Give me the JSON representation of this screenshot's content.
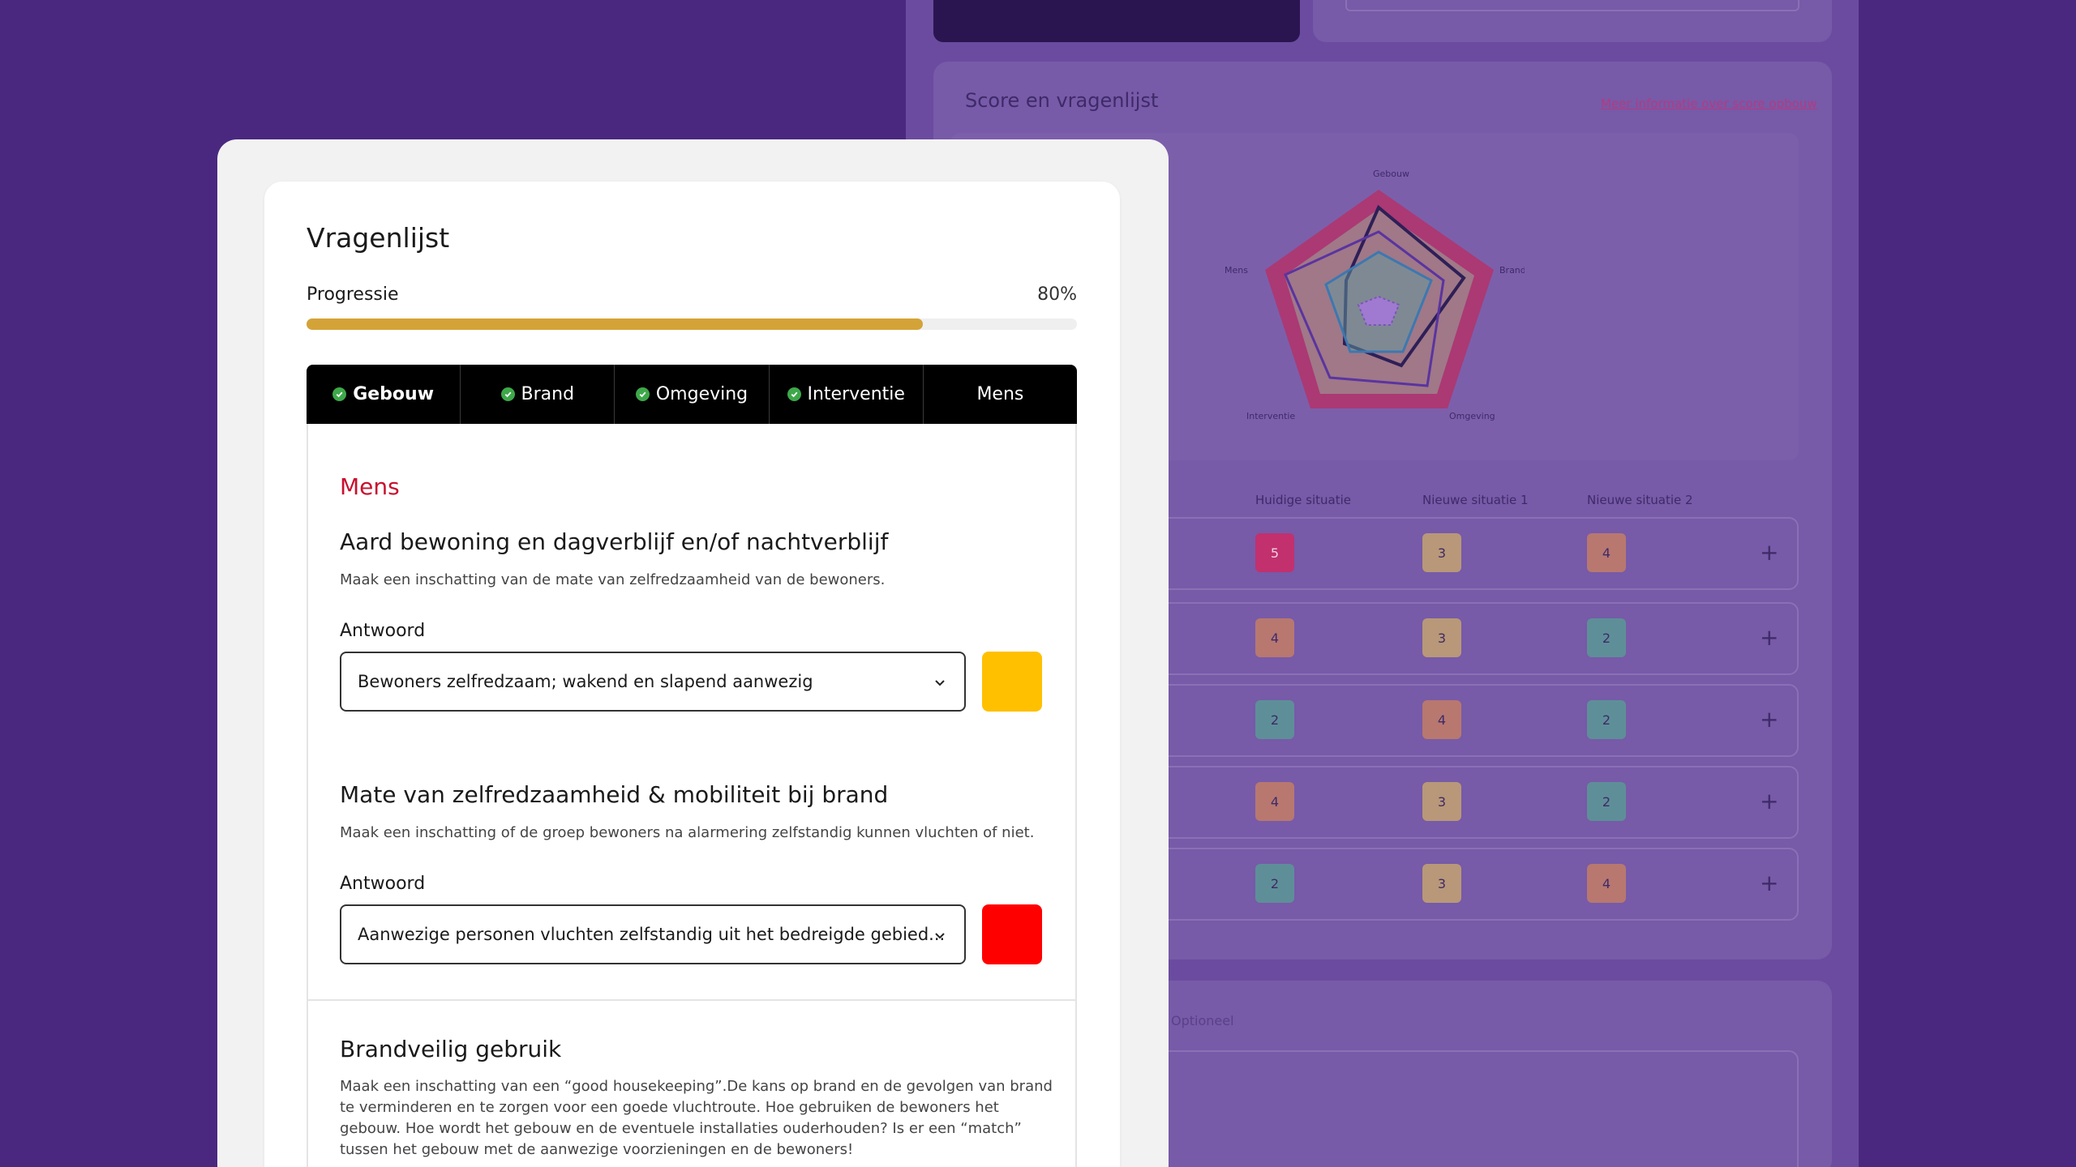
{
  "background": {
    "panel_title": "Score en vragenlijst",
    "panel_link": "Meer informatie over score opbouw",
    "radar_labels": {
      "top": "Gebouw",
      "right": "Brand",
      "bottom_right": "Omgeving",
      "bottom_left": "Interventie",
      "left": "Mens"
    },
    "columns": [
      "Huidige situatie",
      "Nieuwe situatie 1",
      "Nieuwe situatie 2"
    ],
    "rows": [
      [
        "5",
        "3",
        "4"
      ],
      [
        "4",
        "3",
        "2"
      ],
      [
        "2",
        "4",
        "2"
      ],
      [
        "4",
        "3",
        "2"
      ],
      [
        "2",
        "3",
        "4"
      ]
    ],
    "row_action": "+",
    "optional_label": "Optioneel"
  },
  "modal": {
    "title": "Vragenlijst",
    "progress": {
      "label": "Progressie",
      "value_text": "80%",
      "fraction": 0.8
    },
    "tabs": [
      {
        "label": "Gebouw",
        "completed": true,
        "active": true
      },
      {
        "label": "Brand",
        "completed": true,
        "active": false
      },
      {
        "label": "Omgeving",
        "completed": true,
        "active": false
      },
      {
        "label": "Interventie",
        "completed": true,
        "active": false
      },
      {
        "label": "Mens",
        "completed": false,
        "active": false
      }
    ],
    "section_heading": "Mens",
    "questions": [
      {
        "title": "Aard bewoning en dagverblijf en/of nachtverblijf",
        "description": "Maak een inschatting van de mate van zelfredzaamheid van de bewoners.",
        "answer_label": "Antwoord",
        "selected": "Bewoners zelfredzaam;  wakend en slapend aanwezig",
        "score_color": "#ffc000"
      },
      {
        "title": "Mate van zelfredzaamheid & mobiliteit bij brand",
        "description": "Maak een inschatting of de groep bewoners na alarmering zelfstandig kunnen vluchten of niet.",
        "answer_label": "Antwoord",
        "selected": "Aanwezige personen vluchten zelfstandig uit het bedreigde gebied...",
        "score_color": "#ff0000"
      },
      {
        "title": "Brandveilig gebruik",
        "description": "Maak een inschatting van een “good housekeeping”.De kans op brand en de gevolgen van brand te verminderen en te zorgen voor een goede vluchtroute. Hoe gebruiken de bewoners het gebouw. Hoe wordt het gebouw en de eventuele installaties ouderhouden? Is er een “match” tussen het gebouw met de aanwezige voorzieningen en de bewoners!"
      }
    ]
  },
  "colors": {
    "page_background": "#4a2880",
    "progress_fill": "#d4a338",
    "section_heading": "#c8102e",
    "check": "#3ea84a"
  }
}
